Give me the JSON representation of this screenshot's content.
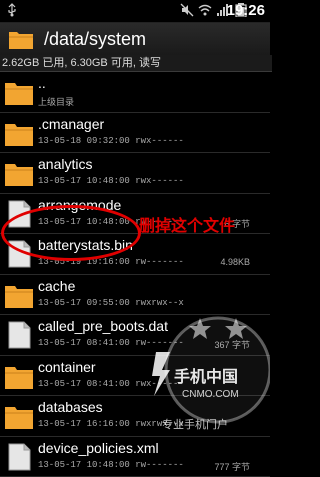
{
  "statusbar": {
    "clock": "19:26"
  },
  "titlebar": {
    "path": "/data/system"
  },
  "infobar": {
    "text": "2.62GB 已用, 6.30GB 可用, 读写"
  },
  "rows": [
    {
      "name": "..",
      "meta": "上级目录",
      "size": "",
      "icon": "parent-folder-icon",
      "type": "folder"
    },
    {
      "name": ".cmanager",
      "meta": "13-05-18 09:32:00  rwx------",
      "size": "",
      "icon": "folder-icon",
      "type": "folder"
    },
    {
      "name": "analytics",
      "meta": "13-05-17 10:48:00  rwx------",
      "size": "",
      "icon": "folder-icon",
      "type": "folder"
    },
    {
      "name": "arrangemode",
      "meta": "13-05-17 10:48:00  rw-------",
      "size": "6 字节",
      "icon": "file-icon",
      "type": "file"
    },
    {
      "name": "batterystats.bin",
      "meta": "13-05-19 19:16:00  rw-------",
      "size": "4.98KB",
      "icon": "file-icon",
      "type": "file"
    },
    {
      "name": "cache",
      "meta": "13-05-17 09:55:00  rwxrwx--x",
      "size": "",
      "icon": "folder-icon",
      "type": "folder"
    },
    {
      "name": "called_pre_boots.dat",
      "meta": "13-05-17 08:41:00  rw-------",
      "size": "367 字节",
      "icon": "file-icon",
      "type": "file"
    },
    {
      "name": "container",
      "meta": "13-05-17 08:41:00  rwx------",
      "size": "",
      "icon": "folder-icon",
      "type": "folder"
    },
    {
      "name": "databases",
      "meta": "13-05-17 16:16:00  rwxrwx--x",
      "size": "",
      "icon": "folder-icon",
      "type": "folder"
    },
    {
      "name": "device_policies.xml",
      "meta": "13-05-17 10:48:00  rw-------",
      "size": "777 字节",
      "icon": "file-icon",
      "type": "file"
    }
  ],
  "annotation": {
    "text": "删掉这个文件"
  },
  "watermark": {
    "brand": "手机中国",
    "domain": "CNMO.COM",
    "slogan": "专业手机门户"
  },
  "colors": {
    "folder": "#f2a531",
    "annotation": "#e00000",
    "background": "#000000"
  }
}
